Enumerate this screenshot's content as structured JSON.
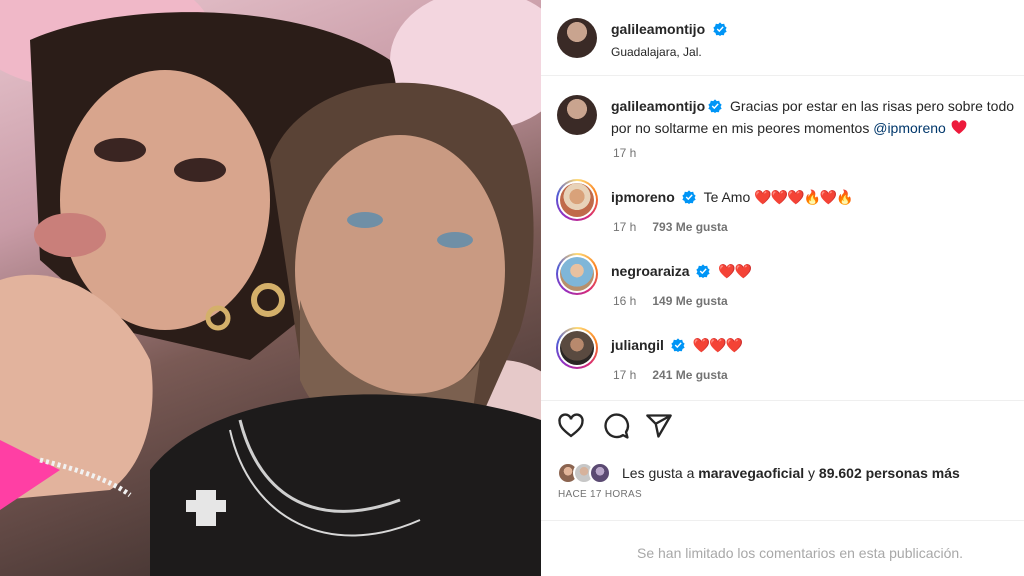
{
  "post": {
    "author": "galileamontijo",
    "location": "Guadalajara, Jal.",
    "caption_line1": "Gracias por estar en las risas pero sobre todo",
    "caption_line2_prefix": "por no soltarme en mis peores momentos ",
    "caption_mention": "@ipmoreno",
    "caption_time": "17 h"
  },
  "comments": [
    {
      "user": "ipmoreno",
      "text": "Te Amo",
      "emojis": "❤️❤️❤️🔥❤️🔥",
      "time": "17 h",
      "likes": "793 Me gusta"
    },
    {
      "user": "negroaraiza",
      "text": "",
      "emojis": "❤️❤️",
      "time": "16 h",
      "likes": "149 Me gusta"
    },
    {
      "user": "juliangil",
      "text": "",
      "emojis": "❤️❤️❤️",
      "time": "17 h",
      "likes": "241 Me gusta"
    }
  ],
  "likes": {
    "prefix": "Les gusta a ",
    "user": "maravegaoficial",
    "middle": " y ",
    "count": "89.602 personas más"
  },
  "posted": "HACE 17 HORAS",
  "footer": "Se han limitado los comentarios en esta publicación.",
  "colors": {
    "verified": "#0095f6",
    "heart": "#ed1a3b",
    "mention": "#00376b",
    "muted": "#737373"
  },
  "icons": [
    "heart-icon",
    "comment-icon",
    "share-icon",
    "verified-icon",
    "fire-icon"
  ]
}
